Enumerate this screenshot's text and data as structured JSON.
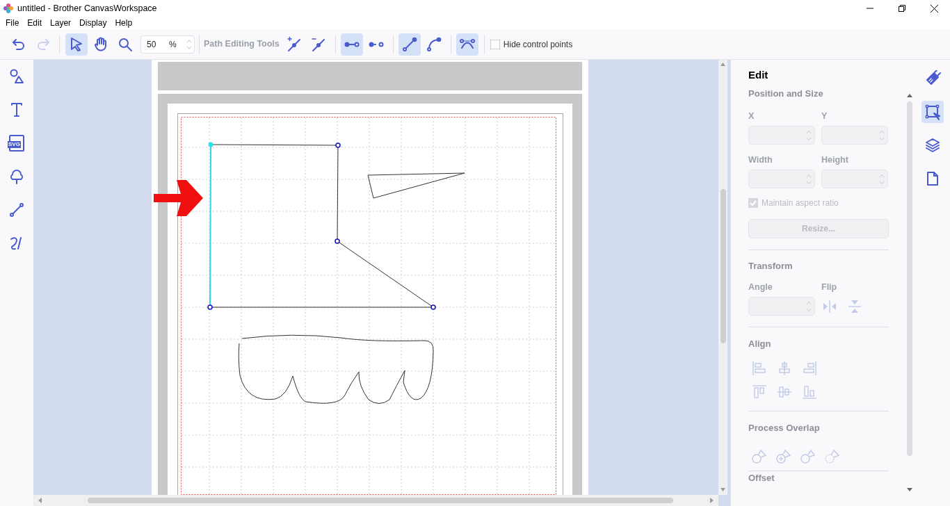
{
  "window": {
    "title": "untitled - Brother CanvasWorkspace"
  },
  "menu": [
    "File",
    "Edit",
    "Layer",
    "Display",
    "Help"
  ],
  "toolbar": {
    "history": [
      {
        "kind": "undo",
        "disabled": false
      },
      {
        "kind": "redo",
        "disabled": true
      }
    ],
    "modes": [
      {
        "kind": "select",
        "selected": true
      },
      {
        "kind": "pan",
        "selected": false
      },
      {
        "kind": "zoom",
        "selected": false
      }
    ],
    "zoom": {
      "value": "50",
      "unit": "%"
    },
    "path_label": "Path Editing Tools",
    "path_groups": [
      [
        {
          "kind": "add-node",
          "selected": false
        },
        {
          "kind": "delete-node",
          "selected": false
        }
      ],
      [
        {
          "kind": "connect",
          "selected": true
        },
        {
          "kind": "disconnect",
          "selected": false
        }
      ],
      [
        {
          "kind": "straight",
          "selected": true
        },
        {
          "kind": "curve",
          "selected": false
        }
      ],
      [
        {
          "kind": "smooth",
          "selected": true
        }
      ]
    ],
    "hide_control_points": {
      "label": "Hide control points",
      "checked": false
    }
  },
  "tools": [
    {
      "kind": "shapes"
    },
    {
      "kind": "text"
    },
    {
      "kind": "svg",
      "label": "SVG"
    },
    {
      "kind": "pattern"
    },
    {
      "kind": "line"
    },
    {
      "kind": "freehand"
    }
  ],
  "edit_panel": {
    "title": "Edit",
    "section": "Position and Size",
    "fields": [
      {
        "label": "X"
      },
      {
        "label": "Y"
      },
      {
        "label": "Width"
      },
      {
        "label": "Height"
      }
    ],
    "maintain_aspect": {
      "label": "Maintain aspect ratio",
      "checked": true
    },
    "resize_button": "Resize...",
    "transform": {
      "title": "Transform",
      "angle_label": "Angle",
      "flip_label": "Flip"
    },
    "align_title": "Align",
    "overlap_title": "Process Overlap",
    "offset_title": "Offset"
  },
  "side_tabs": [
    {
      "kind": "brush",
      "selected": false
    },
    {
      "kind": "edit",
      "selected": true
    },
    {
      "kind": "layers",
      "selected": false
    },
    {
      "kind": "page",
      "selected": false
    }
  ]
}
